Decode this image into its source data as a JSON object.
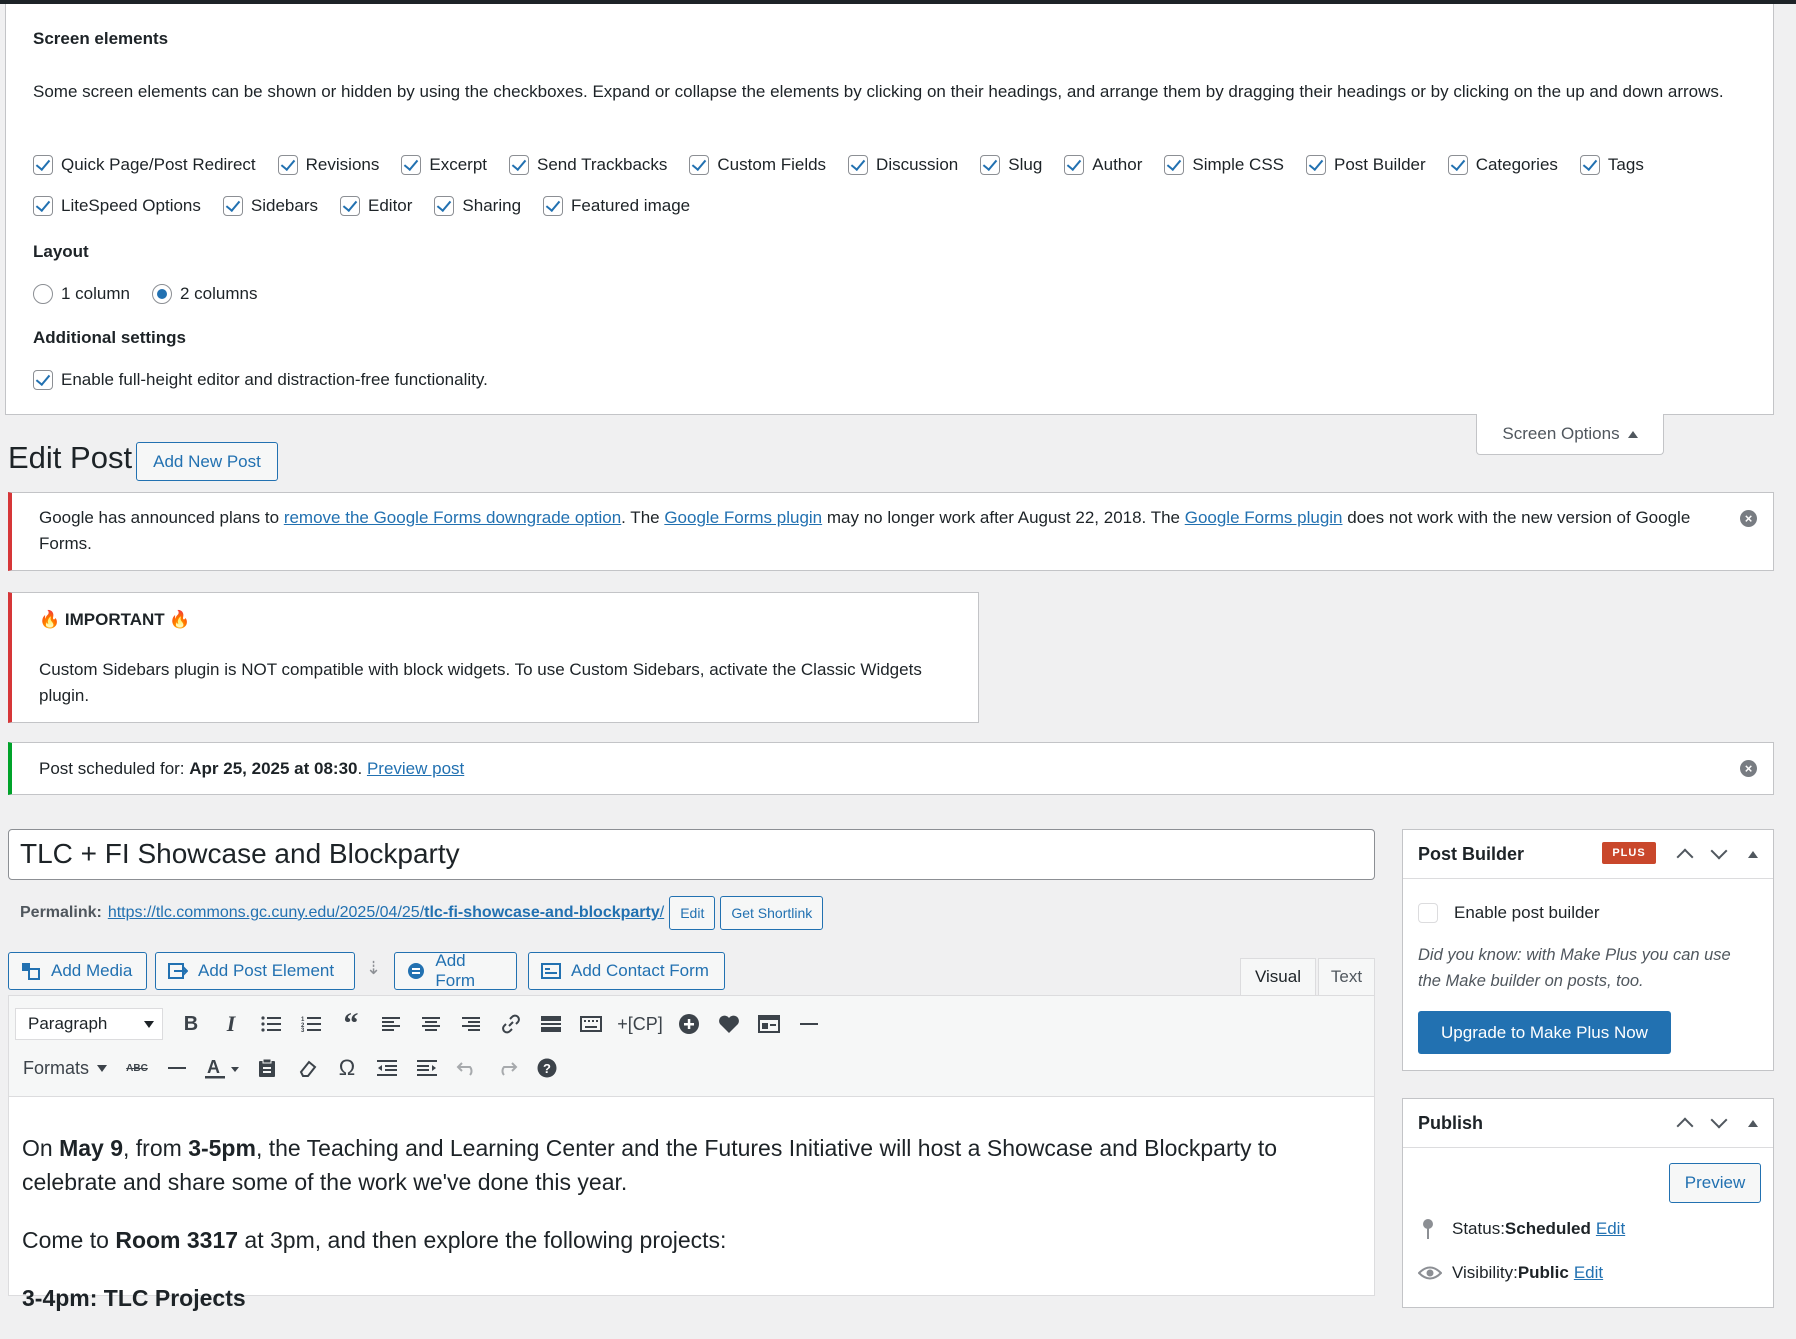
{
  "screen_options": {
    "heading": "Screen elements",
    "description": "Some screen elements can be shown or hidden by using the checkboxes. Expand or collapse the elements by clicking on their headings, and arrange them by dragging their headings or by clicking on the up and down arrows.",
    "row1": [
      "Quick Page/Post Redirect",
      "Revisions",
      "Excerpt",
      "Send Trackbacks",
      "Custom Fields",
      "Discussion",
      "Slug",
      "Author",
      "Simple CSS",
      "Post Builder",
      "Categories",
      "Tags"
    ],
    "row2": [
      "LiteSpeed Options",
      "Sidebars",
      "Editor",
      "Sharing",
      "Featured image"
    ],
    "layout_heading": "Layout",
    "layout_options": [
      "1 column",
      "2 columns"
    ],
    "layout_selected": "2 columns",
    "additional_heading": "Additional settings",
    "additional_option": "Enable full-height editor and distraction-free functionality.",
    "tab_label": "Screen Options"
  },
  "page": {
    "title": "Edit Post",
    "add_new": "Add New Post"
  },
  "notice_google": {
    "t1": "Google has announced plans to ",
    "l1": "remove the Google Forms downgrade option",
    "t2": ". The ",
    "l2": "Google Forms plugin",
    "t3": " may no longer work after August 22, 2018. The ",
    "l3": "Google Forms plugin",
    "t4": " does not work with the new version of Google Forms."
  },
  "notice_important": {
    "title": "🔥 IMPORTANT 🔥",
    "body": "Custom Sidebars plugin is NOT compatible with block widgets. To use Custom Sidebars, activate the Classic Widgets plugin."
  },
  "notice_scheduled": {
    "prefix": "Post scheduled for: ",
    "date": "Apr 25, 2025 at 08:30",
    "sep": ". ",
    "link": "Preview post"
  },
  "post": {
    "title": "TLC + FI Showcase and Blockparty",
    "permalink_label": "Permalink:",
    "permalink_base": "https://tlc.commons.gc.cuny.edu/2025/04/25/",
    "permalink_slug": "tlc-fi-showcase-and-blockparty",
    "permalink_end": "/",
    "edit_btn": "Edit",
    "shortlink_btn": "Get Shortlink"
  },
  "media_buttons": {
    "add_media": "Add Media",
    "add_post_element": "Add Post Element",
    "add_form": "Add Form",
    "add_contact_form": "Add Contact Form"
  },
  "editor_tabs": {
    "visual": "Visual",
    "text": "Text"
  },
  "toolbar": {
    "format_select": "Paragraph",
    "formats": "Formats",
    "cp": "+[CP]"
  },
  "content": {
    "p1_a": "On ",
    "p1_b": "May 9",
    "p1_c": ", from ",
    "p1_d": "3-5pm",
    "p1_e": ", the Teaching and Learning Center and the Futures Initiative will host a Showcase and Blockparty to celebrate and share some of the work we've done this year.",
    "p2_a": "Come to ",
    "p2_b": "Room 3317",
    "p2_c": " at 3pm, and then explore the following projects:",
    "p3": "3-4pm: TLC Projects"
  },
  "post_builder": {
    "title": "Post Builder",
    "badge": "PLUS",
    "enable_label": "Enable post builder",
    "info": "Did you know: with Make Plus you can use the Make builder on posts, too.",
    "upgrade_btn": "Upgrade to Make Plus Now"
  },
  "publish": {
    "title": "Publish",
    "preview_btn": "Preview",
    "status_label": "Status: ",
    "status_value": "Scheduled",
    "status_edit": "Edit",
    "visibility_label": "Visibility: ",
    "visibility_value": "Public",
    "visibility_edit": "Edit"
  },
  "colors": {
    "accent": "#2271b1",
    "error_border": "#d63638",
    "success_border": "#00a32a",
    "badge": "#c9472b"
  }
}
